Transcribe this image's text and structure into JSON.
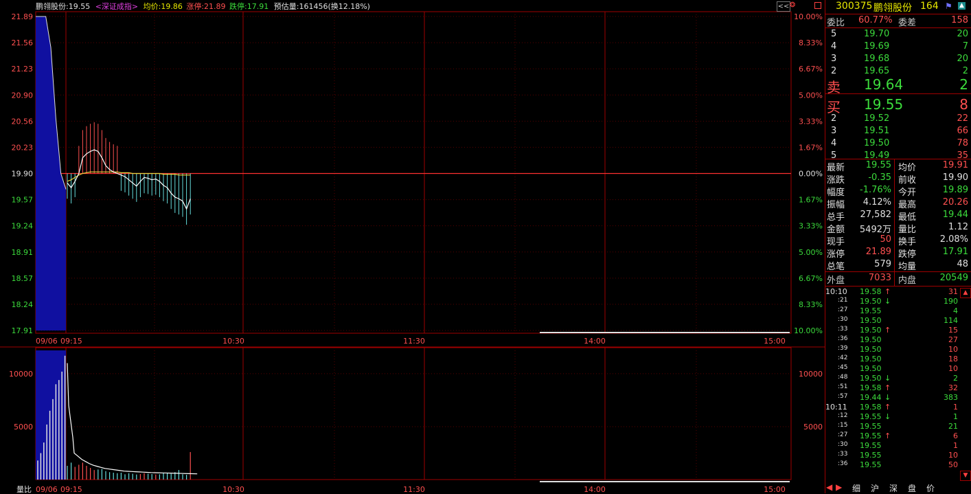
{
  "colors": {
    "up": "#ff5050",
    "down": "#3cdc3c",
    "flat": "#e0e0e0",
    "grid": "#a00000",
    "cyan": "#66dddd",
    "yellow": "#e8e800",
    "blue": "#1010a0",
    "avg": "#e8d23c"
  },
  "header": {
    "name_price": "鹏翎股份:19.55",
    "index_link": "<深证成指>",
    "avg": "均价:19.86",
    "limit_up": "涨停:21.89",
    "limit_down": "跌停:17.91",
    "est_volume": "预估量:161456(换12.18%)",
    "corner_btn": "<<"
  },
  "chart_data": {
    "type": "line",
    "title": "鹏翎股份",
    "prev_close": 19.9,
    "price_ticks": [
      "21.89",
      "21.56",
      "21.23",
      "20.90",
      "20.56",
      "20.23",
      "19.90",
      "19.57",
      "19.24",
      "18.91",
      "18.57",
      "18.24",
      "17.91"
    ],
    "pct_ticks": [
      "10.00%",
      "8.33%",
      "6.67%",
      "5.00%",
      "3.33%",
      "1.67%",
      "0.00%",
      "1.67%",
      "3.33%",
      "5.00%",
      "6.67%",
      "8.33%",
      "10.00%"
    ],
    "x_labels": [
      "09/06",
      "09:15",
      "10:30",
      "11:30",
      "14:00",
      "15:00"
    ],
    "volume_ticks": [
      "10000",
      "5000"
    ],
    "volume_label": "量比",
    "auction_price": [
      21.89,
      21.89,
      21.89,
      21.5,
      20.6,
      19.9,
      19.7
    ],
    "price": [
      19.78,
      19.72,
      19.8,
      19.9,
      20.1,
      20.15,
      20.18,
      20.2,
      20.18,
      20.1,
      20.0,
      19.95,
      19.92,
      19.9,
      19.88,
      19.86,
      19.82,
      19.78,
      19.74,
      19.8,
      19.85,
      19.84,
      19.82,
      19.83,
      19.8,
      19.75,
      19.72,
      19.65,
      19.6,
      19.58,
      19.55,
      19.45,
      19.58
    ],
    "avg_price": [
      19.8,
      19.82,
      19.85,
      19.88,
      19.9,
      19.91,
      19.92,
      19.92,
      19.92,
      19.92,
      19.92,
      19.92,
      19.92,
      19.92,
      19.91,
      19.91,
      19.91,
      19.9,
      19.9,
      19.9,
      19.9,
      19.9,
      19.9,
      19.9,
      19.9,
      19.89,
      19.89,
      19.89,
      19.89,
      19.88,
      19.88,
      19.88,
      19.88
    ],
    "auction_volume": [
      1800,
      2500,
      3500,
      5200,
      6500,
      7600,
      9000,
      9400,
      10200,
      11700
    ],
    "volume": [
      1300,
      1600,
      1200,
      1400,
      1600,
      1300,
      1100,
      900,
      950,
      1000,
      800,
      700,
      650,
      600,
      650,
      500,
      600,
      550,
      480,
      520,
      600,
      550,
      520,
      480,
      500,
      650,
      600,
      550,
      700,
      900,
      500,
      450,
      2600
    ],
    "volume_avg": [
      2500,
      2200,
      1900,
      1700,
      1500,
      1350,
      1250,
      1150,
      1050,
      1000,
      950,
      900,
      850,
      800,
      780,
      760,
      740,
      720,
      700,
      680,
      660,
      650,
      640,
      630,
      620,
      610,
      600,
      590,
      580,
      570,
      560,
      550,
      540
    ]
  },
  "quote": {
    "code": "300375",
    "name": "鹏翎股份",
    "extra": "164",
    "ratio_label": "委比",
    "ratio": "60.77%",
    "diff_label": "委差",
    "diff": "158",
    "asks": [
      {
        "lvl": "5",
        "price": "19.70",
        "vol": "20"
      },
      {
        "lvl": "4",
        "price": "19.69",
        "vol": "7"
      },
      {
        "lvl": "3",
        "price": "19.68",
        "vol": "20"
      },
      {
        "lvl": "2",
        "price": "19.65",
        "vol": "2"
      },
      {
        "lvl": "卖",
        "price": "19.64",
        "vol": "2"
      }
    ],
    "bids": [
      {
        "lvl": "买",
        "price": "19.55",
        "vol": "8"
      },
      {
        "lvl": "2",
        "price": "19.52",
        "vol": "22"
      },
      {
        "lvl": "3",
        "price": "19.51",
        "vol": "66"
      },
      {
        "lvl": "4",
        "price": "19.50",
        "vol": "78"
      },
      {
        "lvl": "5",
        "price": "19.49",
        "vol": "35"
      }
    ],
    "stats": [
      {
        "l1": "最新",
        "v1": "19.55",
        "c1": "down",
        "l2": "均价",
        "v2": "19.91",
        "c2": "up"
      },
      {
        "l1": "涨跌",
        "v1": "-0.35",
        "c1": "down",
        "l2": "前收",
        "v2": "19.90",
        "c2": "flat"
      },
      {
        "l1": "幅度",
        "v1": "-1.76%",
        "c1": "down",
        "l2": "今开",
        "v2": "19.89",
        "c2": "down"
      },
      {
        "l1": "振幅",
        "v1": "4.12%",
        "c1": "flat",
        "l2": "最高",
        "v2": "20.26",
        "c2": "up"
      },
      {
        "l1": "总手",
        "v1": "27,582",
        "c1": "flat",
        "l2": "最低",
        "v2": "19.44",
        "c2": "down"
      },
      {
        "l1": "金额",
        "v1": "5492万",
        "c1": "flat",
        "l2": "量比",
        "v2": "1.12",
        "c2": "flat"
      },
      {
        "l1": "现手",
        "v1": "50",
        "c1": "up",
        "l2": "换手",
        "v2": "2.08%",
        "c2": "flat"
      },
      {
        "l1": "涨停",
        "v1": "21.89",
        "c1": "up",
        "l2": "跌停",
        "v2": "17.91",
        "c2": "down"
      },
      {
        "l1": "总笔",
        "v1": "579",
        "c1": "flat",
        "l2": "均量",
        "v2": "48",
        "c2": "flat"
      }
    ],
    "outer_label": "外盘",
    "outer": "7033",
    "inner_label": "内盘",
    "inner": "20549"
  },
  "ticks": [
    {
      "t": "10:10",
      "p": "19.58",
      "a": "↑",
      "v": "31",
      "d": "up"
    },
    {
      "t": ":21",
      "p": "19.50",
      "a": "↓",
      "v": "190",
      "d": "down"
    },
    {
      "t": ":27",
      "p": "19.55",
      "a": "",
      "v": "4",
      "d": "flat"
    },
    {
      "t": ":30",
      "p": "19.50",
      "a": "",
      "v": "114",
      "d": "flat"
    },
    {
      "t": ":33",
      "p": "19.50",
      "a": "↑",
      "v": "15",
      "d": "up"
    },
    {
      "t": ":36",
      "p": "19.50",
      "a": "",
      "v": "27",
      "d": "up"
    },
    {
      "t": ":39",
      "p": "19.50",
      "a": "",
      "v": "10",
      "d": "up"
    },
    {
      "t": ":42",
      "p": "19.50",
      "a": "",
      "v": "18",
      "d": "up"
    },
    {
      "t": ":45",
      "p": "19.50",
      "a": "",
      "v": "10",
      "d": "up"
    },
    {
      "t": ":48",
      "p": "19.50",
      "a": "↓",
      "v": "2",
      "d": "down"
    },
    {
      "t": ":51",
      "p": "19.58",
      "a": "↑",
      "v": "32",
      "d": "up"
    },
    {
      "t": ":57",
      "p": "19.44",
      "a": "↓",
      "v": "383",
      "d": "down"
    },
    {
      "t": "10:11",
      "p": "19.58",
      "a": "↑",
      "v": "1",
      "d": "up"
    },
    {
      "t": ":12",
      "p": "19.55",
      "a": "↓",
      "v": "1",
      "d": "down"
    },
    {
      "t": ":15",
      "p": "19.55",
      "a": "",
      "v": "21",
      "d": "flat"
    },
    {
      "t": ":27",
      "p": "19.55",
      "a": "↑",
      "v": "6",
      "d": "up"
    },
    {
      "t": ":30",
      "p": "19.55",
      "a": "",
      "v": "1",
      "d": "up"
    },
    {
      "t": ":33",
      "p": "19.55",
      "a": "",
      "v": "10",
      "d": "up"
    },
    {
      "t": ":36",
      "p": "19.55",
      "a": "",
      "v": "50",
      "d": "up"
    }
  ],
  "tabs": [
    "细",
    "沪",
    "深",
    "盘",
    "价"
  ]
}
